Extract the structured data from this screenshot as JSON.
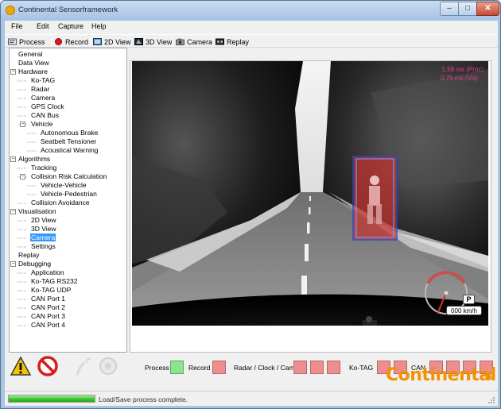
{
  "window": {
    "title": "Continental Sensorframework",
    "controls": {
      "minimize": "–",
      "maximize": "□",
      "close": "✕"
    }
  },
  "menu": [
    "File",
    "Edit",
    "Capture",
    "Help"
  ],
  "toolbar": [
    {
      "label": "Process",
      "icon": "process-icon"
    },
    {
      "label": "Record",
      "icon": "record-icon"
    },
    {
      "label": "2D View",
      "icon": "2d-view-icon"
    },
    {
      "label": "3D View",
      "icon": "3d-view-icon"
    },
    {
      "label": "Camera",
      "icon": "camera-icon"
    },
    {
      "label": "Replay",
      "icon": "replay-icon"
    }
  ],
  "tree": [
    {
      "label": "General",
      "level": 0
    },
    {
      "label": "Data View",
      "level": 0
    },
    {
      "label": "Hardware",
      "level": 0,
      "expander": "−"
    },
    {
      "label": "Ko-TAG",
      "level": 1
    },
    {
      "label": "Radar",
      "level": 1
    },
    {
      "label": "Camera",
      "level": 1
    },
    {
      "label": "GPS Clock",
      "level": 1
    },
    {
      "label": "CAN Bus",
      "level": 1
    },
    {
      "label": "Vehicle",
      "level": 1,
      "expander": "−"
    },
    {
      "label": "Autonomous Brake",
      "level": 2
    },
    {
      "label": "Seatbelt Tensioner",
      "level": 2
    },
    {
      "label": "Acoustical Warning",
      "level": 2
    },
    {
      "label": "Algorithms",
      "level": 0,
      "expander": "−"
    },
    {
      "label": "Tracking",
      "level": 1
    },
    {
      "label": "Collision Risk Calculation",
      "level": 1,
      "expander": "−"
    },
    {
      "label": "Vehicle-Vehicle",
      "level": 2
    },
    {
      "label": "Vehicle-Pedestrian",
      "level": 2
    },
    {
      "label": "Collision Avoidance",
      "level": 1
    },
    {
      "label": "Visualisation",
      "level": 0,
      "expander": "−"
    },
    {
      "label": "2D View",
      "level": 1
    },
    {
      "label": "3D View",
      "level": 1
    },
    {
      "label": "Camera",
      "level": 1,
      "selected": true
    },
    {
      "label": "Settings",
      "level": 1
    },
    {
      "label": "Replay",
      "level": 0
    },
    {
      "label": "Debugging",
      "level": 0,
      "expander": "−"
    },
    {
      "label": "Application",
      "level": 1
    },
    {
      "label": "Ko-TAG RS232",
      "level": 1
    },
    {
      "label": "Ko-TAG UDP",
      "level": 1
    },
    {
      "label": "CAN Port 1",
      "level": 1
    },
    {
      "label": "CAN Port 2",
      "level": 1
    },
    {
      "label": "CAN Port 3",
      "level": 1
    },
    {
      "label": "CAN Port 4",
      "level": 1
    }
  ],
  "camera_overlay": {
    "proc_time": "1.59 ms (Proc)",
    "vis_time": "0.75 ms (Vis)",
    "gear": "P",
    "speed": "000 km/h"
  },
  "status_indicators": {
    "process_label": "Process",
    "record_label": "Record",
    "radar_label": "Radar / Clock / Cam",
    "kotag_label": "Ko-TAG",
    "can_label": "CAN",
    "process_color": "#8ee38e",
    "inactive_color": "#ee8d8d"
  },
  "warning_icons": [
    "warning-triangle-icon",
    "no-entry-icon",
    "belt-icon",
    "brake-disc-icon"
  ],
  "brand": {
    "name": "Continental",
    "logo_icon": "horse-icon"
  },
  "statusbar": {
    "progress": 1.0,
    "message": "Load/Save process complete."
  }
}
